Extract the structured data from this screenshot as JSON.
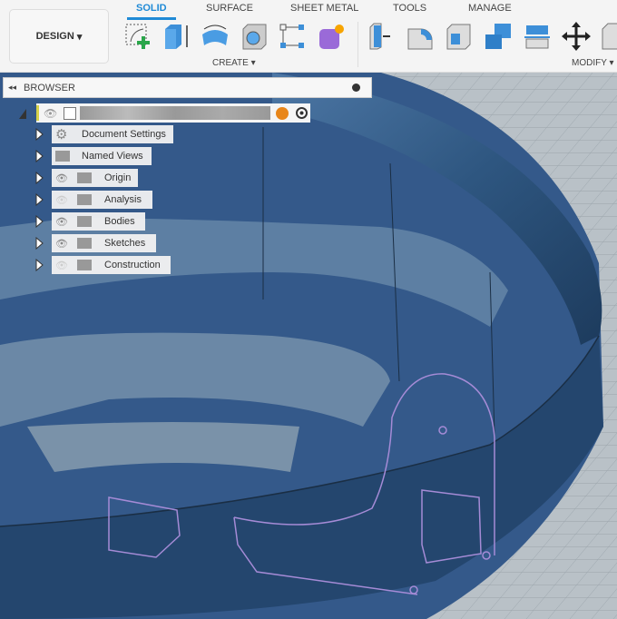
{
  "toolbar": {
    "workspace": "DESIGN",
    "tabs": [
      "SOLID",
      "SURFACE",
      "SHEET METAL",
      "TOOLS",
      "MANAGE"
    ],
    "active_tab": "SOLID",
    "create_label": "CREATE",
    "modify_label": "MODIFY",
    "create_tools": [
      "create-sketch-icon",
      "extrude-icon",
      "revolve-icon",
      "hole-icon",
      "pattern-icon",
      "form-icon"
    ],
    "modify_tools": [
      "press-pull-icon",
      "fillet-icon",
      "shell-icon",
      "combine-icon",
      "offset-face-icon",
      "move-icon",
      "modify-more-icon"
    ]
  },
  "browser": {
    "title": "BROWSER",
    "items": [
      {
        "label": "Document Settings",
        "icon": "gear-icon"
      },
      {
        "label": "Named Views",
        "icon": "folder-icon"
      },
      {
        "label": "Origin",
        "icon": "folder-icon",
        "visible": true
      },
      {
        "label": "Analysis",
        "icon": "folder-icon",
        "visible": false
      },
      {
        "label": "Bodies",
        "icon": "folder-icon",
        "visible": true
      },
      {
        "label": "Sketches",
        "icon": "folder-icon",
        "visible": true
      },
      {
        "label": "Construction",
        "icon": "folder-icon",
        "visible": false
      }
    ]
  },
  "colors": {
    "accent": "#1f8ad6",
    "body": "#2f5680",
    "sketch": "#a58bd6"
  }
}
